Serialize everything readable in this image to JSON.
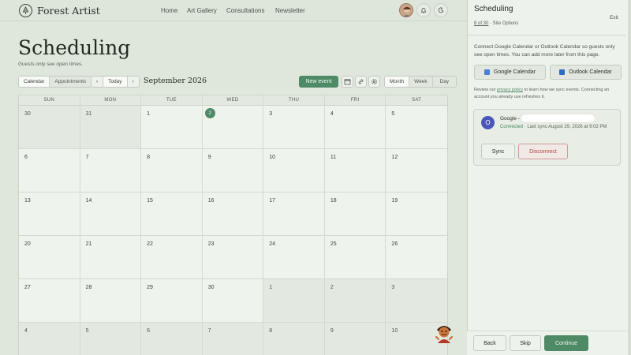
{
  "brand": {
    "name": "Forest Artist",
    "icon": "tree-icon"
  },
  "nav": {
    "links": [
      "Home",
      "Art Gallery",
      "Consultations",
      "Newsletter"
    ]
  },
  "page": {
    "title": "Scheduling",
    "subtitle": "Guests only see open times."
  },
  "toolbar": {
    "view_tabs": [
      "Calendar",
      "Appointments"
    ],
    "today": "Today",
    "month_label": "September 2026",
    "new_event": "New event",
    "range_tabs": [
      "Month",
      "Week",
      "Day"
    ]
  },
  "calendar": {
    "weekdays": [
      "SUN",
      "MON",
      "TUE",
      "WED",
      "THU",
      "FRI",
      "SAT"
    ],
    "today_day": "2",
    "days": [
      {
        "n": "30",
        "other": true
      },
      {
        "n": "31",
        "other": true
      },
      {
        "n": "1"
      },
      {
        "n": "2",
        "today": true
      },
      {
        "n": "3"
      },
      {
        "n": "4"
      },
      {
        "n": "5"
      },
      {
        "n": "6"
      },
      {
        "n": "7"
      },
      {
        "n": "8"
      },
      {
        "n": "9"
      },
      {
        "n": "10"
      },
      {
        "n": "11"
      },
      {
        "n": "12"
      },
      {
        "n": "13"
      },
      {
        "n": "14"
      },
      {
        "n": "15"
      },
      {
        "n": "16"
      },
      {
        "n": "17"
      },
      {
        "n": "18"
      },
      {
        "n": "19"
      },
      {
        "n": "20"
      },
      {
        "n": "21"
      },
      {
        "n": "22"
      },
      {
        "n": "23"
      },
      {
        "n": "24"
      },
      {
        "n": "25"
      },
      {
        "n": "26"
      },
      {
        "n": "27"
      },
      {
        "n": "28"
      },
      {
        "n": "29"
      },
      {
        "n": "30"
      },
      {
        "n": "1",
        "other": true
      },
      {
        "n": "2",
        "other": true
      },
      {
        "n": "3",
        "other": true
      },
      {
        "n": "4",
        "other": true
      },
      {
        "n": "5",
        "other": true
      },
      {
        "n": "6",
        "other": true
      },
      {
        "n": "7",
        "other": true
      },
      {
        "n": "8",
        "other": true
      },
      {
        "n": "9",
        "other": true
      },
      {
        "n": "10",
        "other": true
      }
    ]
  },
  "panel": {
    "title": "Scheduling",
    "exit": "Exit",
    "step_link": "8 of 30",
    "step_rest": " · Site Options",
    "description": "Connect Google Calendar or Outlook Calendar so guests only see open times. You can add more later from this page.",
    "google_btn": "Google Calendar",
    "outlook_btn": "Outlook Calendar",
    "review_pre": "Review our ",
    "review_link": "privacy policy",
    "review_post": " to learn how we sync events. Connecting an account you already use refreshes it.",
    "account": {
      "initial": "O",
      "name": "Google -",
      "status": "Connected",
      "last_sync": " · Last sync August 29, 2026 at 9:02 PM",
      "sync": "Sync",
      "disconnect": "Disconnect"
    },
    "footer": {
      "back": "Back",
      "skip": "Skip",
      "continue": "Continue"
    }
  },
  "colors": {
    "accent": "#4f8a66",
    "danger": "#b4453c",
    "background": "#dfe6dc"
  }
}
